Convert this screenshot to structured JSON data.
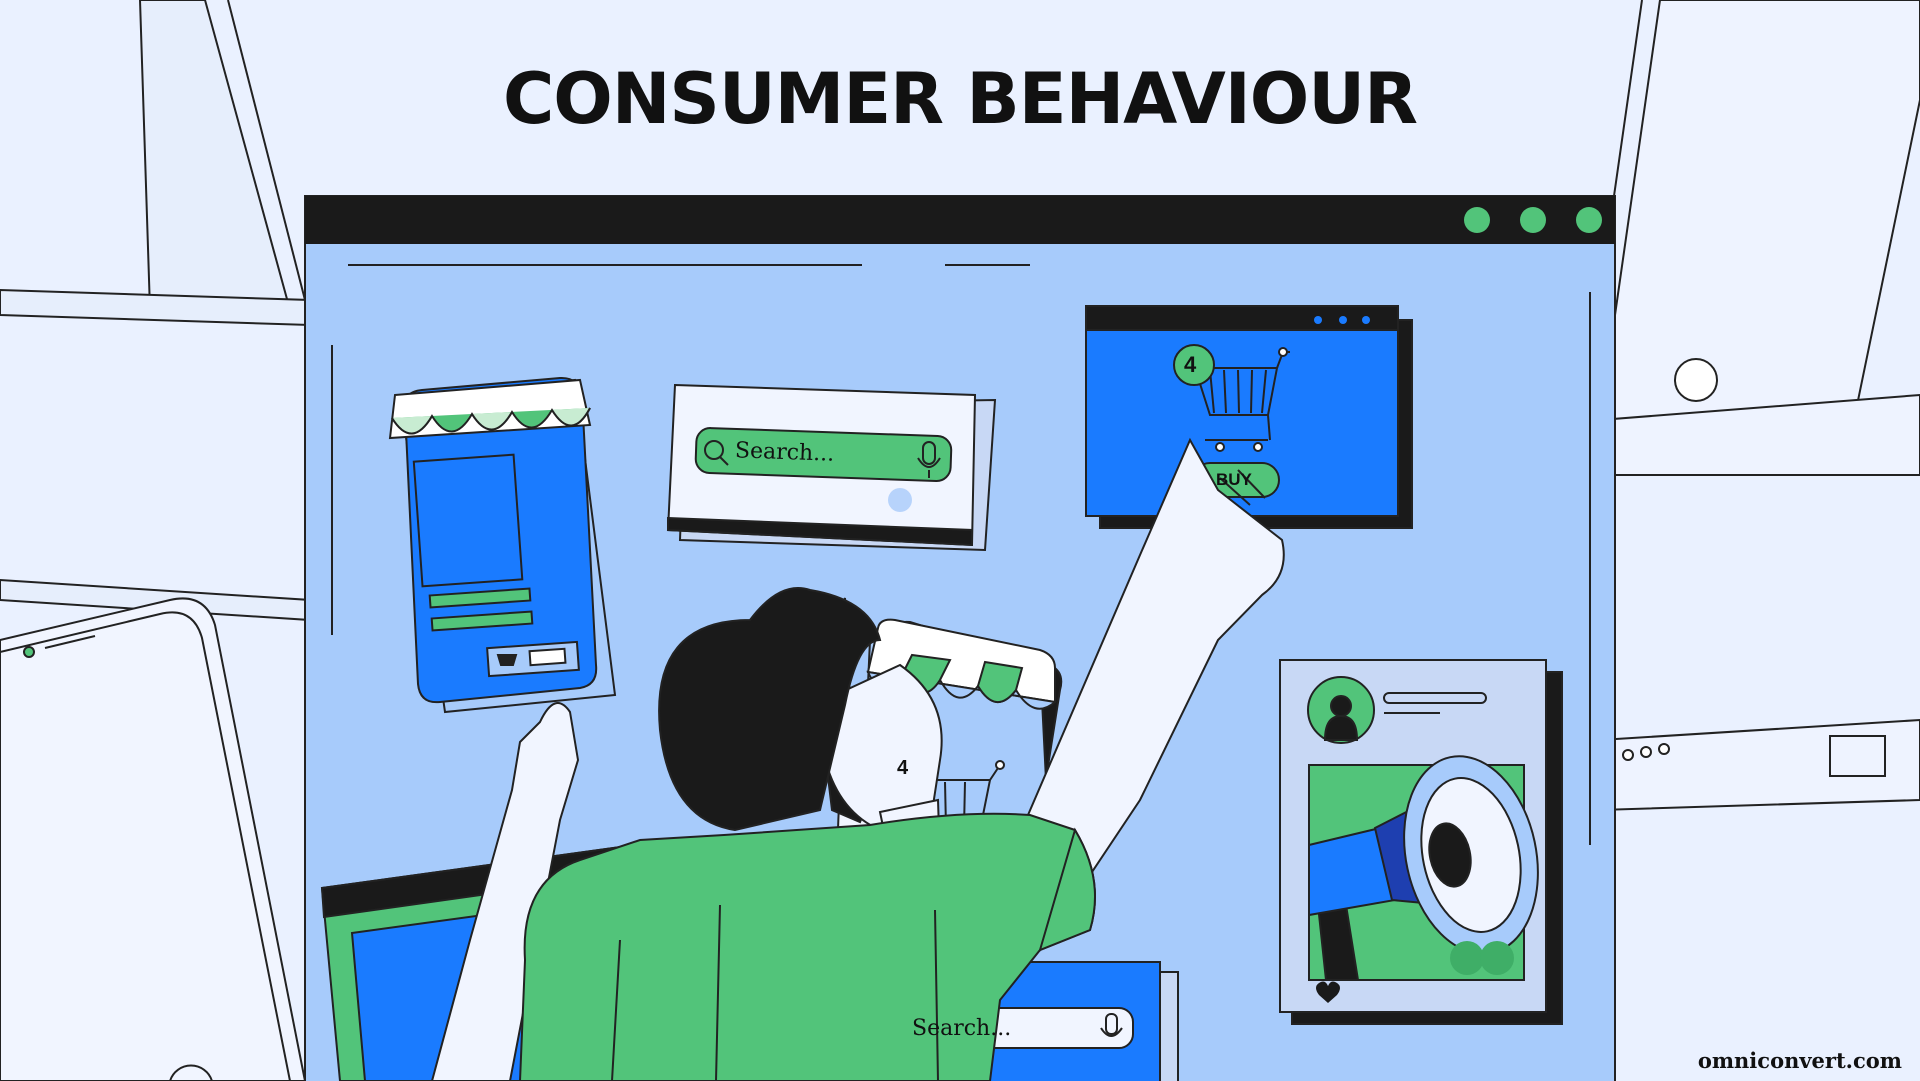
{
  "page": {
    "title": "CONSUMER BEHAVIOUR",
    "brand": "omniconvert.com"
  },
  "colors": {
    "background": "#eaf1ff",
    "window_fill": "#a7cbfb",
    "blue": "#1a7bff",
    "green": "#52c47a",
    "light_green": "#c8ecd2",
    "dark": "#1a1a1a",
    "dark_blue": "#1e3fb0"
  },
  "search_bar_top": {
    "placeholder": "Search...",
    "icons": [
      "search-icon",
      "microphone-icon"
    ]
  },
  "search_bar_bottom": {
    "placeholder": "Search...",
    "icons": [
      "microphone-icon"
    ]
  },
  "cart_panel": {
    "badge_count": "4",
    "button_label": "BUY",
    "icons": [
      "shopping-cart-icon"
    ]
  },
  "shop_card": {
    "badge_count": "4",
    "icons": [
      "shopping-cart-icon"
    ]
  },
  "social_card": {
    "icons": [
      "avatar-icon",
      "megaphone-icon",
      "heart-icon"
    ]
  },
  "window_controls": [
    "green-dot",
    "green-dot",
    "green-dot"
  ]
}
